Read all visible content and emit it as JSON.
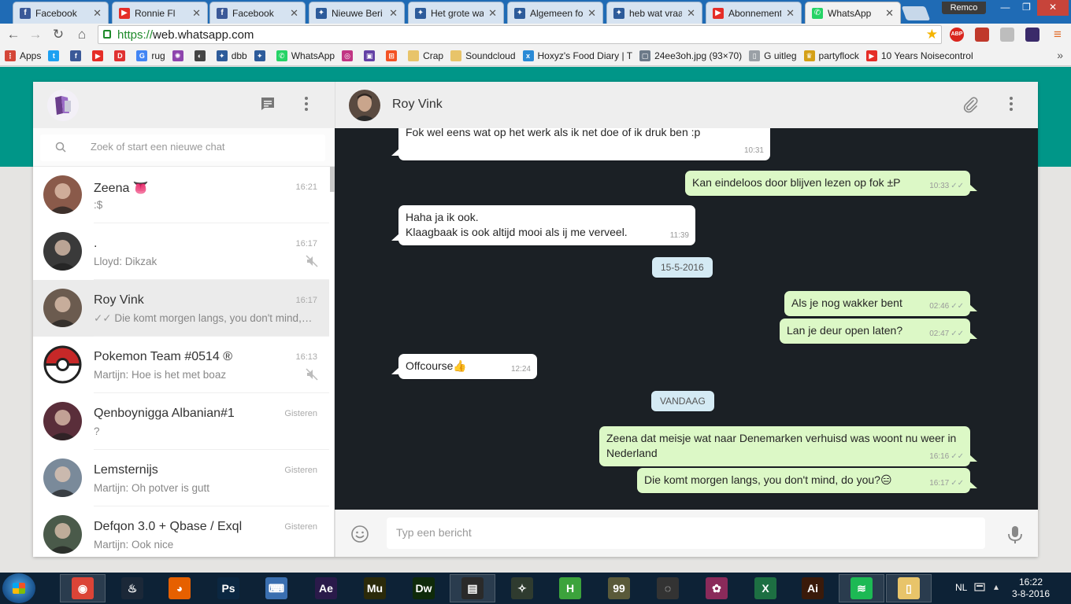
{
  "browser": {
    "tabs": [
      {
        "title": "Facebook",
        "icon": "facebook-icon",
        "color": "#3b5998",
        "glyph": "f"
      },
      {
        "title": "Ronnie Fl",
        "icon": "youtube-icon",
        "color": "#e52d27",
        "glyph": "▶"
      },
      {
        "title": "Facebook",
        "icon": "facebook-icon",
        "color": "#3b5998",
        "glyph": "f"
      },
      {
        "title": "Nieuwe Beri",
        "icon": "fok-icon",
        "color": "#2d5b9a",
        "glyph": "✦"
      },
      {
        "title": "Het grote wa",
        "icon": "fok-icon",
        "color": "#2d5b9a",
        "glyph": "✦"
      },
      {
        "title": "Algemeen fo",
        "icon": "fok-icon",
        "color": "#2d5b9a",
        "glyph": "✦"
      },
      {
        "title": "heb wat vraa",
        "icon": "fok-icon",
        "color": "#2d5b9a",
        "glyph": "✦"
      },
      {
        "title": "Abonnement",
        "icon": "youtube-icon",
        "color": "#e52d27",
        "glyph": "▶"
      },
      {
        "title": "WhatsApp",
        "icon": "whatsapp-icon",
        "color": "#25d366",
        "glyph": "✆"
      }
    ],
    "profile_name": "Remco",
    "url_scheme": "https://",
    "url_host": "web.whatsapp.com",
    "bookmarks": [
      {
        "label": "Apps",
        "icon": "apps-grid-icon",
        "color": "#d44638",
        "glyph": "⋮"
      },
      {
        "label": "",
        "icon": "twitter-icon",
        "color": "#1da1f2",
        "glyph": "t"
      },
      {
        "label": "",
        "icon": "facebook-icon",
        "color": "#3b5998",
        "glyph": "f"
      },
      {
        "label": "",
        "icon": "youtube-icon",
        "color": "#e52d27",
        "glyph": "▶"
      },
      {
        "label": "",
        "icon": "deezer-icon",
        "color": "#e03131",
        "glyph": "D"
      },
      {
        "label": "rug",
        "icon": "google-icon",
        "color": "#4285f4",
        "glyph": "G"
      },
      {
        "label": "",
        "icon": "bookmark-badge-icon",
        "color": "#8e44ad",
        "glyph": "✺"
      },
      {
        "label": "",
        "icon": "bookmark-eye-icon",
        "color": "#444444",
        "glyph": "◐"
      },
      {
        "label": "dbb",
        "icon": "fok-icon",
        "color": "#2d5b9a",
        "glyph": "✦"
      },
      {
        "label": "",
        "icon": "fok-icon",
        "color": "#2d5b9a",
        "glyph": "✦"
      },
      {
        "label": "WhatsApp",
        "icon": "whatsapp-icon",
        "color": "#25d366",
        "glyph": "✆"
      },
      {
        "label": "",
        "icon": "instagram-icon",
        "color": "#c13584",
        "glyph": "◎"
      },
      {
        "label": "",
        "icon": "twitch-icon",
        "color": "#6441a5",
        "glyph": "▣"
      },
      {
        "label": "",
        "icon": "windows-icon",
        "color": "#f35325",
        "glyph": "⊞"
      },
      {
        "label": "Crap",
        "icon": "folder-icon",
        "color": "#e8c46a",
        "glyph": ""
      },
      {
        "label": "Soundcloud",
        "icon": "folder-icon",
        "color": "#e8c46a",
        "glyph": ""
      },
      {
        "label": "Hoxyz's Food Diary | T",
        "icon": "xiaomi-icon",
        "color": "#2a8ad6",
        "glyph": "x"
      },
      {
        "label": "24ee3oh.jpg (93×70)",
        "icon": "image-file-icon",
        "color": "#6c7a89",
        "glyph": "▢"
      },
      {
        "label": "G uitleg",
        "icon": "page-icon",
        "color": "#9aa0a6",
        "glyph": "▯"
      },
      {
        "label": "partyflock",
        "icon": "partyflock-icon",
        "color": "#d4a017",
        "glyph": "♛"
      },
      {
        "label": "10 Years Noisecontrol",
        "icon": "youtube-icon",
        "color": "#e52d27",
        "glyph": "▶"
      }
    ]
  },
  "whatsapp": {
    "search_placeholder": "Zoek of start een nieuwe chat",
    "chats": [
      {
        "name": "Zeena 👅",
        "time": "16:21",
        "last": ":$",
        "ticks": false,
        "muted": false,
        "avatar": "#8a5a4a"
      },
      {
        "name": ".",
        "time": "16:17",
        "last": "Lloyd: Dikzak",
        "ticks": false,
        "muted": true,
        "avatar": "#3a3a3a"
      },
      {
        "name": "Roy Vink",
        "time": "16:17",
        "last": "Die komt morgen langs, you don't mind, do you?",
        "ticks": true,
        "muted": false,
        "avatar": "#6b5b4f"
      },
      {
        "name": "Pokemon Team #0514 ®",
        "time": "16:13",
        "last": "Martijn: Hoe is het met boaz",
        "ticks": false,
        "muted": true,
        "avatar": "pokeball"
      },
      {
        "name": "Qenboynigga Albanian#1",
        "time": "Gisteren",
        "last": "?",
        "ticks": false,
        "muted": false,
        "avatar": "#5a2e3a"
      },
      {
        "name": "Lemsternijs",
        "time": "Gisteren",
        "last": "Martijn: Oh potver is gutt",
        "ticks": false,
        "muted": false,
        "avatar": "#7a8a9a"
      },
      {
        "name": "Defqon 3.0 + Qbase / Exql",
        "time": "Gisteren",
        "last": "Martijn: Ook nice",
        "ticks": false,
        "muted": false,
        "avatar": "#4a5a4a"
      }
    ],
    "conversation": {
      "name": "Roy Vink",
      "composer_placeholder": "Typ een bericht",
      "messages": [
        {
          "dir": "in",
          "text": "Fok wel eens wat op het werk als ik net doe of ik druk ben  :p",
          "time": "10:31"
        },
        {
          "dir": "out",
          "text": "Kan eindeloos door blijven lezen op fok ±P",
          "time": "10:33"
        },
        {
          "dir": "in",
          "text": "Haha ja ik ook.\nKlaagbaak is ook altijd mooi als ij me verveel.",
          "time": "11:39"
        },
        {
          "dir": "date",
          "text": "15-5-2016"
        },
        {
          "dir": "out",
          "text": "Als je nog wakker bent",
          "time": "02:46"
        },
        {
          "dir": "out",
          "text": "Lan je deur open laten?",
          "time": "02:47"
        },
        {
          "dir": "in",
          "text": "Offcourse👍",
          "time": "12:24"
        },
        {
          "dir": "date",
          "text": "VANDAAG"
        },
        {
          "dir": "out",
          "text": "Zeena dat meisje wat naar Denemarken verhuisd was woont nu weer in Nederland",
          "time": "16:16"
        },
        {
          "dir": "out",
          "text": "Die komt morgen langs, you don't mind, do you?😑",
          "time": "16:17"
        }
      ]
    }
  },
  "taskbar": {
    "apps": [
      {
        "name": "chrome-icon",
        "color": "#db4437",
        "glyph": "◉",
        "open": true
      },
      {
        "name": "steam-icon",
        "color": "#1b2838",
        "glyph": "♨",
        "open": false
      },
      {
        "name": "firefox-icon",
        "color": "#e66000",
        "glyph": "◕",
        "open": false
      },
      {
        "name": "photoshop-icon",
        "color": "#0b2741",
        "glyph": "Ps",
        "open": false
      },
      {
        "name": "keyboard-app-icon",
        "color": "#3a6fb0",
        "glyph": "⌨",
        "open": false
      },
      {
        "name": "after-effects-icon",
        "color": "#2a1a4a",
        "glyph": "Ae",
        "open": false
      },
      {
        "name": "muse-icon",
        "color": "#2b2a0a",
        "glyph": "Mu",
        "open": false
      },
      {
        "name": "dreamweaver-icon",
        "color": "#0f2a0a",
        "glyph": "Dw",
        "open": false
      },
      {
        "name": "video-editor-icon",
        "color": "#2a2a2a",
        "glyph": "▤",
        "open": true
      },
      {
        "name": "cs-go-icon",
        "color": "#2f3b2f",
        "glyph": "✧",
        "open": false
      },
      {
        "name": "hotspot-shield-icon",
        "color": "#3ca33c",
        "glyph": "H",
        "open": false
      },
      {
        "name": "ninety-nine-icon",
        "color": "#5a5a3a",
        "glyph": "99",
        "open": false
      },
      {
        "name": "rayman-disc-icon",
        "color": "#333333",
        "glyph": "◌",
        "open": false
      },
      {
        "name": "game-character-icon",
        "color": "#8a2a5a",
        "glyph": "✿",
        "open": false
      },
      {
        "name": "excel-icon",
        "color": "#1d6f42",
        "glyph": "X",
        "open": false
      },
      {
        "name": "illustrator-icon",
        "color": "#3a1a0a",
        "glyph": "Ai",
        "open": false
      },
      {
        "name": "spotify-icon",
        "color": "#1db954",
        "glyph": "≋",
        "open": true
      },
      {
        "name": "file-explorer-icon",
        "color": "#e8c46a",
        "glyph": "▯",
        "open": true
      }
    ],
    "language": "NL",
    "time": "16:22",
    "date": "3-8-2016"
  }
}
